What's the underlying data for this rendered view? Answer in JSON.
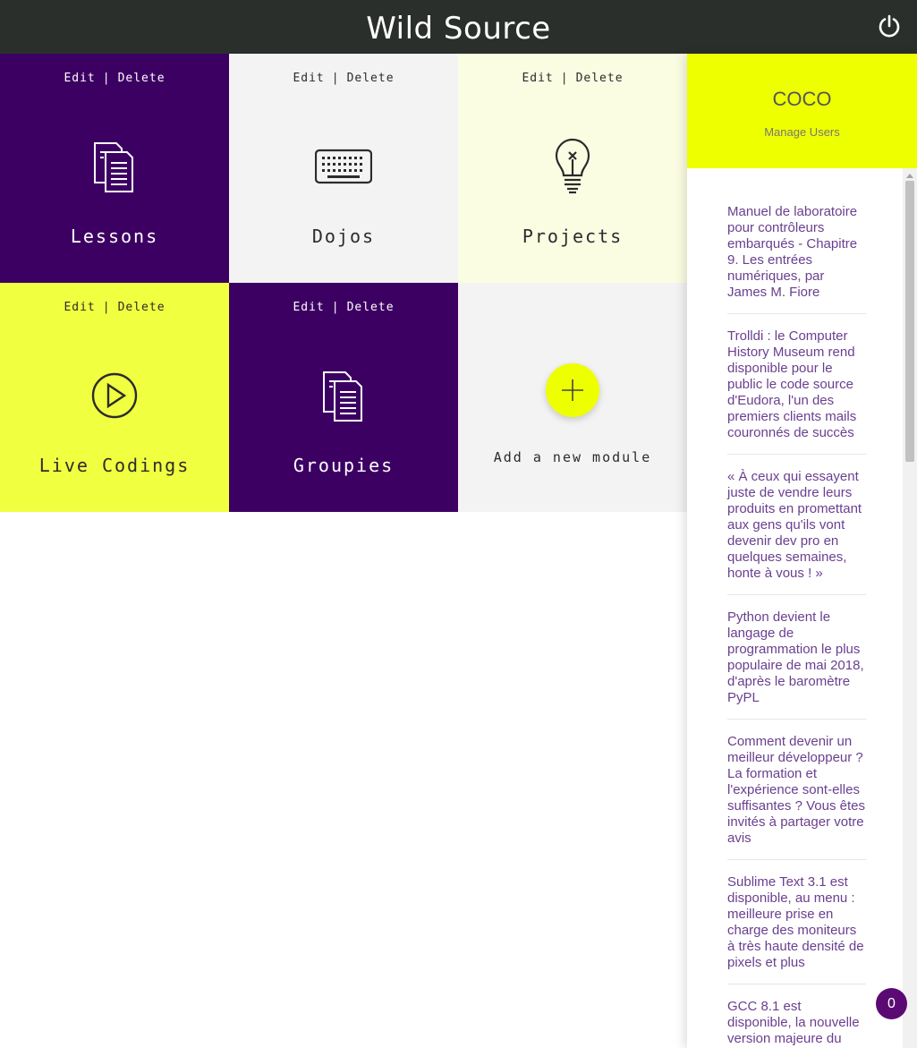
{
  "header": {
    "title": "Wild Source",
    "power_icon": "power-icon"
  },
  "modules": [
    {
      "label": "Lessons",
      "edit": "Edit",
      "separator": "|",
      "delete": "Delete",
      "icon": "documents-icon",
      "color": "#3c0063"
    },
    {
      "label": "Dojos",
      "edit": "Edit",
      "separator": "|",
      "delete": "Delete",
      "icon": "keyboard-icon",
      "color": "#f3f3f3"
    },
    {
      "label": "Projects",
      "edit": "Edit",
      "separator": "|",
      "delete": "Delete",
      "icon": "lightbulb-icon",
      "color": "#fbfde3"
    },
    {
      "label": "Live Codings",
      "edit": "Edit",
      "separator": "|",
      "delete": "Delete",
      "icon": "play-circle-icon",
      "color": "#f1ff41"
    },
    {
      "label": "Groupies",
      "edit": "Edit",
      "separator": "|",
      "delete": "Delete",
      "icon": "documents-icon",
      "color": "#3c0063"
    }
  ],
  "add_module": {
    "label": "Add a new module",
    "icon": "plus-icon"
  },
  "sidebar": {
    "user_name": "COCO",
    "manage_users": "Manage Users",
    "news": [
      "Manuel de laboratoire pour contrôleurs embarqués - Chapitre 9. Les entrées numériques, par James M. Fiore",
      "Trolldi : le Computer History Museum rend disponible pour le public le code source d'Eudora, l'un des premiers clients mails couronnés de succès",
      "« À ceux qui essayent juste de vendre leurs produits en promettant aux gens qu'ils vont devenir dev pro en quelques semaines, honte à vous ! »",
      "Python devient le langage de programmation le plus populaire de mai 2018, d'après le baromètre PyPL",
      "Comment devenir un meilleur développeur ? La formation et l'expérience sont-elles suffisantes ? Vous êtes invités à partager votre avis",
      "Sublime Text 3.1 est disponible, au menu : meilleure prise en charge des moniteurs à très haute densité de pixels et plus",
      "GCC 8.1 est disponible, la nouvelle version majeure du"
    ]
  },
  "badge": {
    "count": "0"
  },
  "colors": {
    "header": "#2b2f2c",
    "purple": "#3c0063",
    "yellow": "#eeff00",
    "link": "#6a3f8f"
  }
}
